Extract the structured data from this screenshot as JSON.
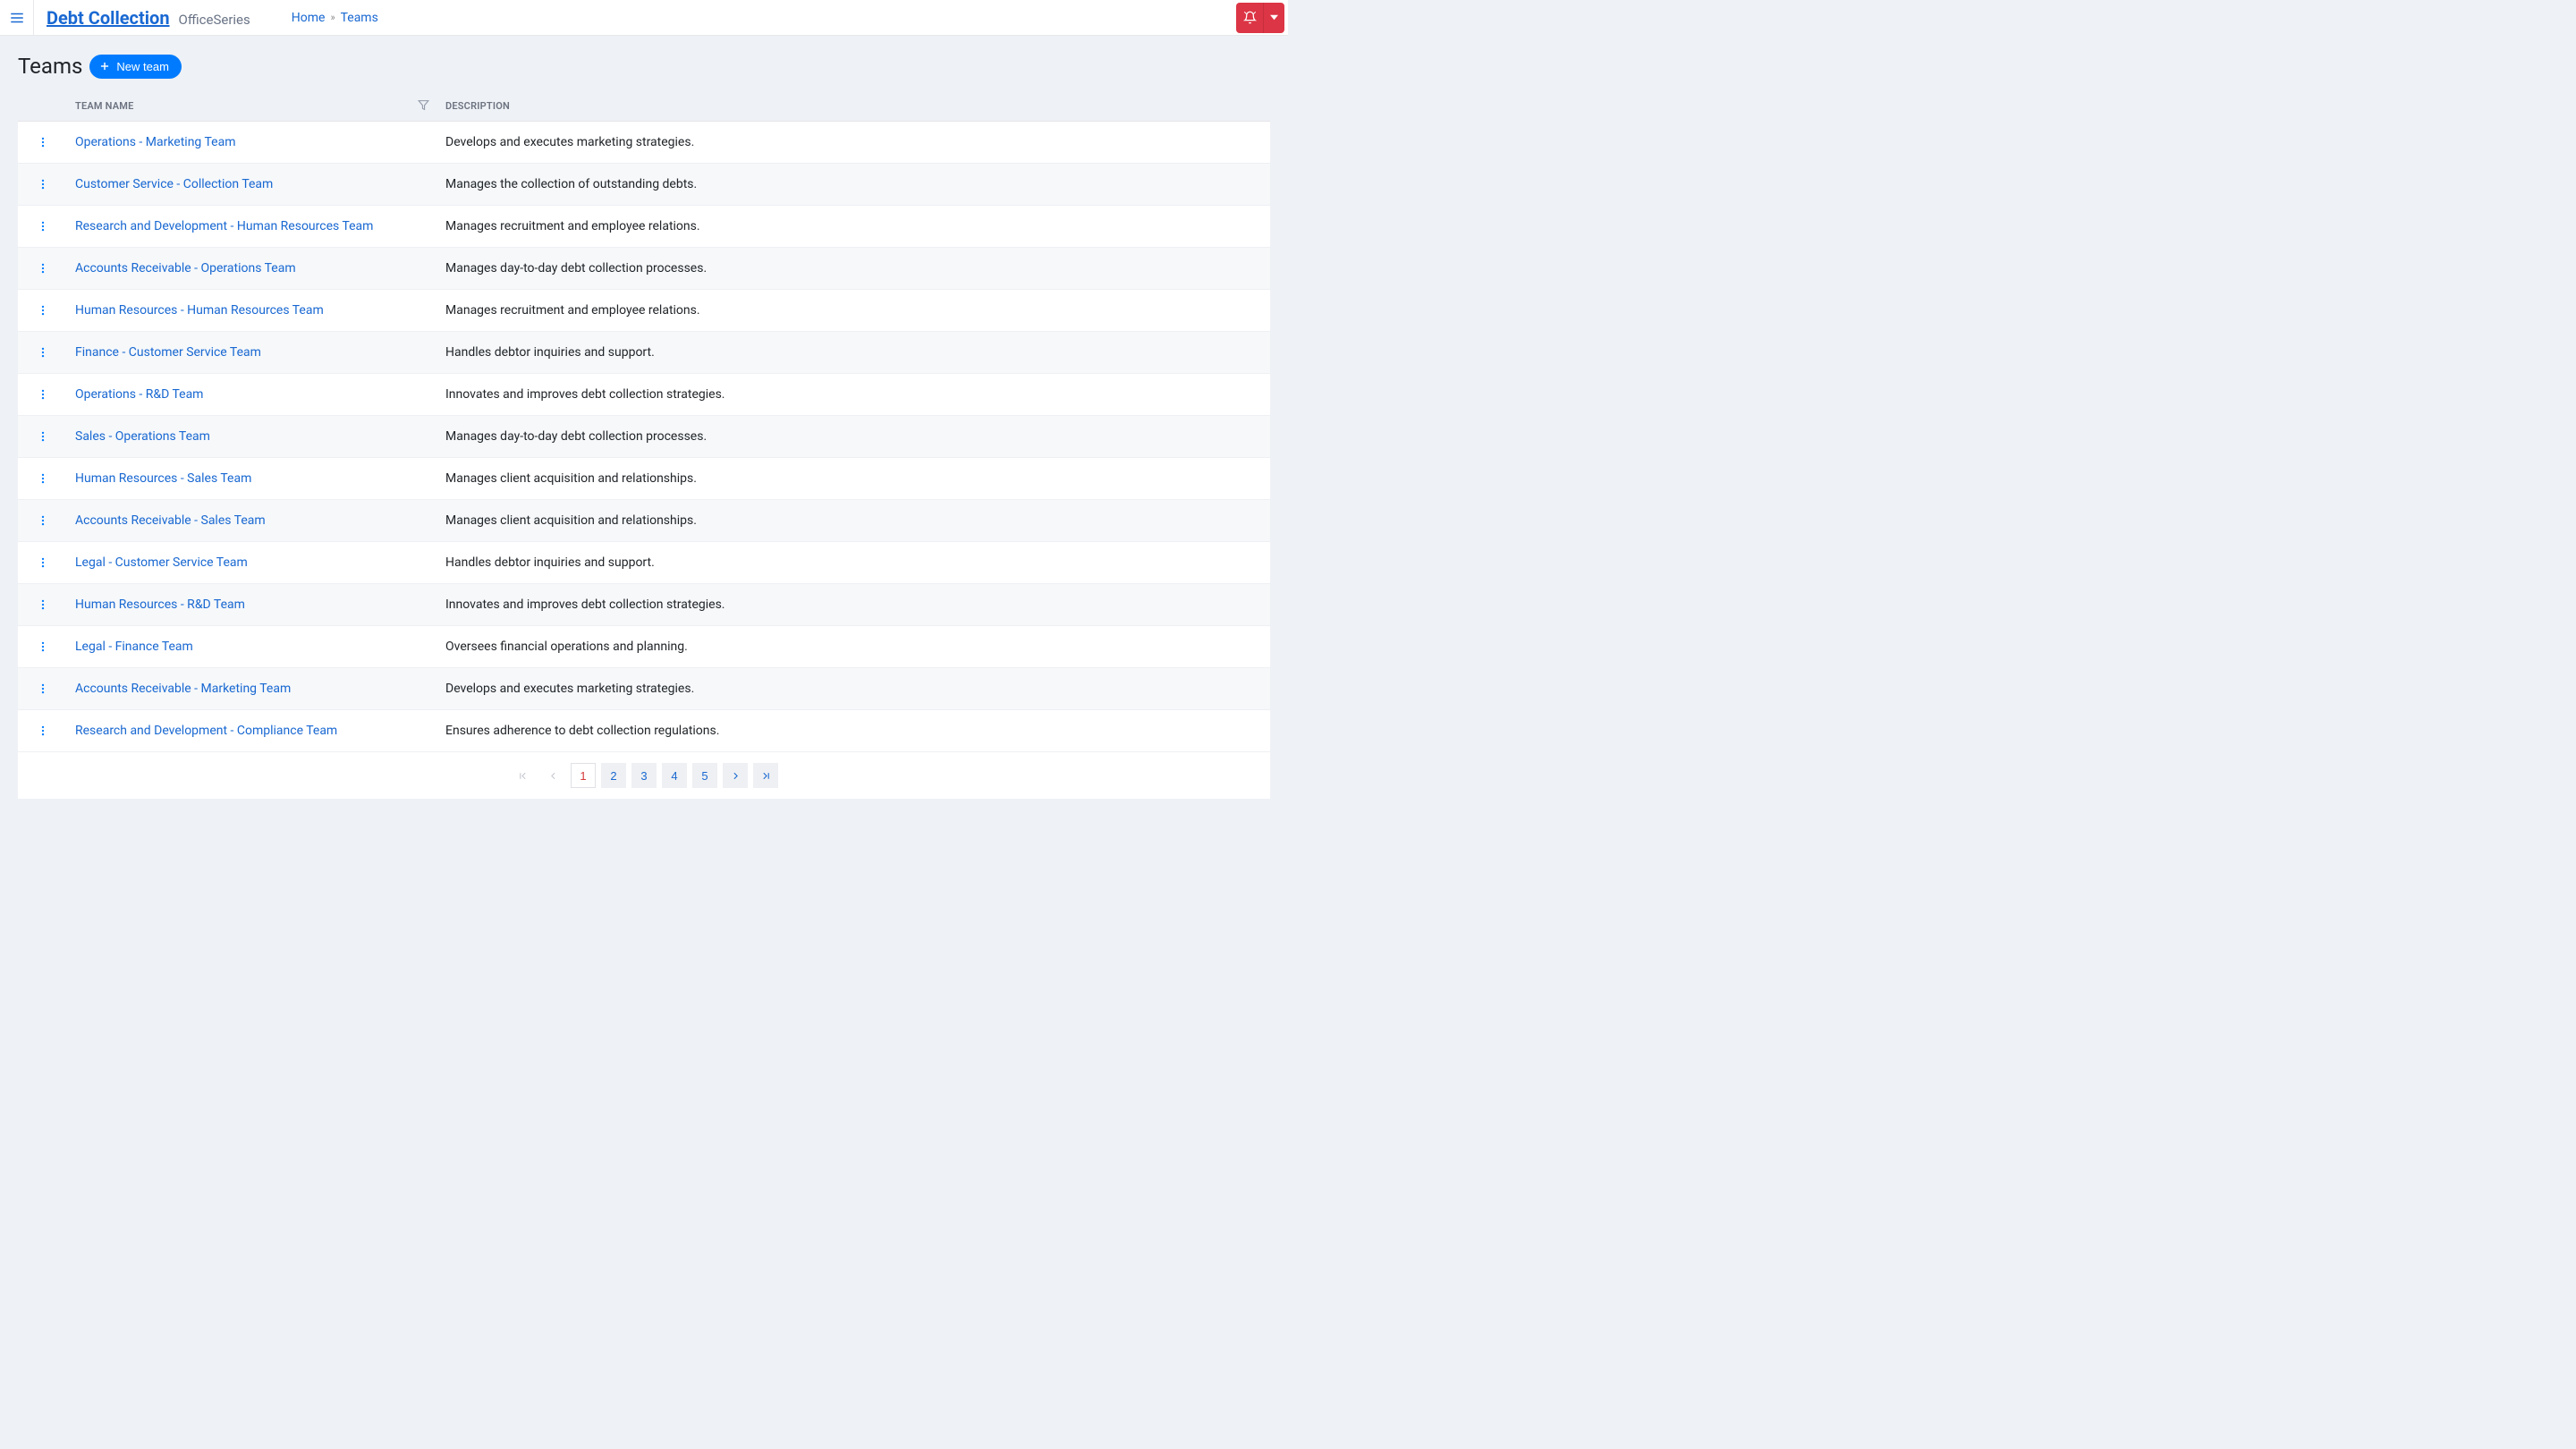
{
  "brand": {
    "title": "Debt Collection",
    "subtitle": "OfficeSeries"
  },
  "breadcrumb": {
    "home": "Home",
    "current": "Teams"
  },
  "page": {
    "title": "Teams",
    "new_button": "New team"
  },
  "table": {
    "headers": {
      "name": "Team Name",
      "description": "Description"
    },
    "rows": [
      {
        "name": "Operations - Marketing Team",
        "description": "Develops and executes marketing strategies."
      },
      {
        "name": "Customer Service - Collection Team",
        "description": "Manages the collection of outstanding debts."
      },
      {
        "name": "Research and Development - Human Resources Team",
        "description": "Manages recruitment and employee relations."
      },
      {
        "name": "Accounts Receivable - Operations Team",
        "description": "Manages day-to-day debt collection processes."
      },
      {
        "name": "Human Resources - Human Resources Team",
        "description": "Manages recruitment and employee relations."
      },
      {
        "name": "Finance - Customer Service Team",
        "description": "Handles debtor inquiries and support."
      },
      {
        "name": "Operations - R&D Team",
        "description": "Innovates and improves debt collection strategies."
      },
      {
        "name": "Sales - Operations Team",
        "description": "Manages day-to-day debt collection processes."
      },
      {
        "name": "Human Resources - Sales Team",
        "description": "Manages client acquisition and relationships."
      },
      {
        "name": "Accounts Receivable - Sales Team",
        "description": "Manages client acquisition and relationships."
      },
      {
        "name": "Legal - Customer Service Team",
        "description": "Handles debtor inquiries and support."
      },
      {
        "name": "Human Resources - R&D Team",
        "description": "Innovates and improves debt collection strategies."
      },
      {
        "name": "Legal - Finance Team",
        "description": "Oversees financial operations and planning."
      },
      {
        "name": "Accounts Receivable - Marketing Team",
        "description": "Develops and executes marketing strategies."
      },
      {
        "name": "Research and Development - Compliance Team",
        "description": "Ensures adherence to debt collection regulations."
      }
    ]
  },
  "pagination": {
    "pages": [
      "1",
      "2",
      "3",
      "4",
      "5"
    ],
    "active_index": 0
  }
}
